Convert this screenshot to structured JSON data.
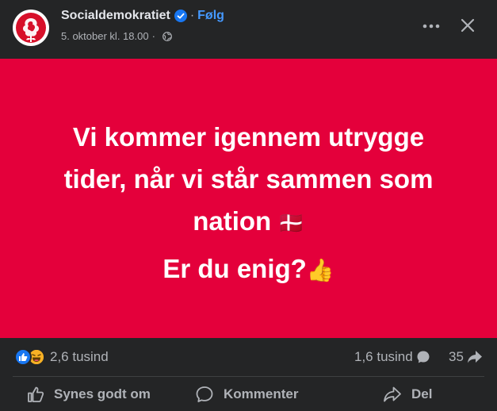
{
  "post": {
    "author": "Socialdemokratiet",
    "follow_label": "Følg",
    "separator": "·",
    "timestamp": "5. oktober kl. 18.00",
    "meta_separator": "·",
    "image_text_lines": [
      "Vi kommer igennem utrygge",
      "tider, når vi står sammen som",
      "nation"
    ],
    "flag_emoji": "🇩🇰",
    "image_question": "Er du enig?",
    "thumbs_emoji": "👍",
    "image_background": "#e4003b"
  },
  "stats": {
    "reactions_count": "2,6 tusind",
    "comments_count": "1,6 tusind",
    "shares_count": "35"
  },
  "actions": {
    "like_label": "Synes godt om",
    "comment_label": "Kommenter",
    "share_label": "Del"
  },
  "icons": {
    "avatar": "red-rose-logo",
    "verified": "verified-badge-icon",
    "privacy": "globe-icon",
    "more": "more-options-icon",
    "close": "close-icon"
  },
  "colors": {
    "background": "#242526",
    "accent": "#4599ff",
    "brand_red": "#e4003b"
  }
}
